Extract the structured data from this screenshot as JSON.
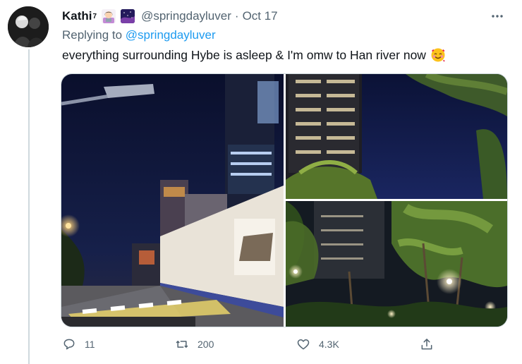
{
  "tweet": {
    "display_name": "Kathi",
    "name_superscript": "7",
    "handle": "@springdayluver",
    "separator": "·",
    "time": "Oct 17",
    "replying_prefix": "Replying to",
    "replying_to": "@springdayluver",
    "text": "everything surrounding Hybe is asleep & I'm omw to Han river now",
    "emoji_after_name": [
      "woman-technologist-emoji",
      "night-sky-emoji"
    ],
    "text_emoji": "smiling-face-with-hearts-emoji"
  },
  "media": {
    "photos": [
      {
        "name": "street-night-photo"
      },
      {
        "name": "building-night-photo"
      },
      {
        "name": "trees-streetlight-photo"
      }
    ]
  },
  "actions": {
    "reply_count": "11",
    "retweet_count": "200",
    "like_count": "4.3K"
  },
  "icons": {
    "more": "more-icon",
    "reply": "reply-icon",
    "retweet": "retweet-icon",
    "like": "heart-icon",
    "share": "share-icon"
  },
  "colors": {
    "link": "#1d9bf0",
    "secondary_text": "#536471",
    "primary_text": "#0f1419",
    "border": "#cfd9de"
  }
}
